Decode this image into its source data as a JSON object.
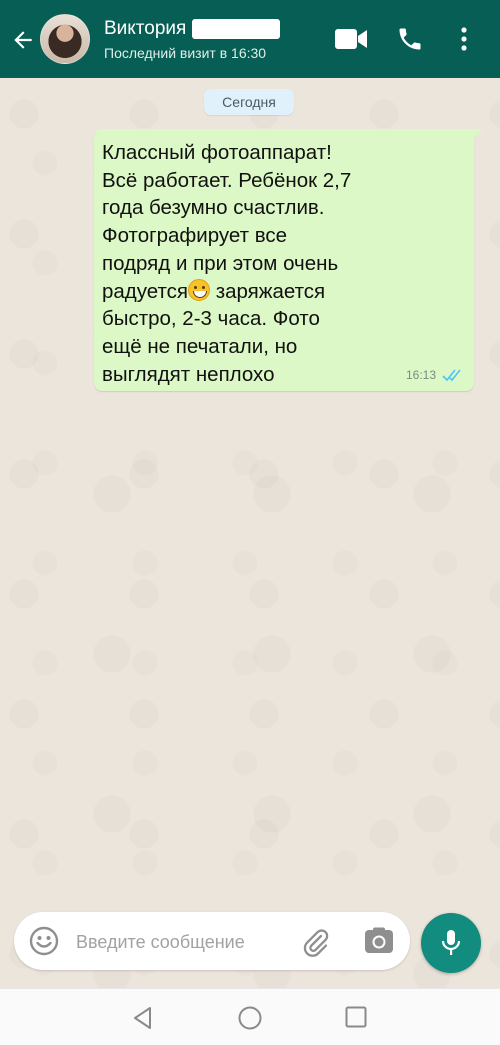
{
  "header": {
    "contact_name": "Виктория",
    "last_seen": "Последний визит в 16:30",
    "background_color": "#075e54",
    "icons": [
      "back-arrow-icon",
      "video-call-icon",
      "phone-icon",
      "more-options-icon"
    ]
  },
  "chat": {
    "date_label": "Сегодня",
    "messages": [
      {
        "direction": "outgoing",
        "lines": [
          "Классный фотоаппарат!",
          "Всё работает. Ребёнок 2,7",
          "года безумно счастлив.",
          "Фотографирует все",
          "подряд и при этом очень",
          "радуется",
          " заряжается",
          "быстро, 2-3 часа. Фото",
          "ещё не печатали, но",
          "выглядят неплохо"
        ],
        "emoji": "grinning-face-emoji",
        "time": "16:13",
        "status": "read",
        "bubble_color": "#dcf8c6",
        "tick_color": "#4fc3f7"
      }
    ]
  },
  "composer": {
    "placeholder": "Введите сообщение",
    "icons": [
      "emoji-icon",
      "attach-icon",
      "camera-icon",
      "mic-icon"
    ],
    "mic_color": "#128c7e"
  },
  "navbar": {
    "icons": [
      "nav-back-icon",
      "nav-home-icon",
      "nav-recents-icon"
    ]
  }
}
